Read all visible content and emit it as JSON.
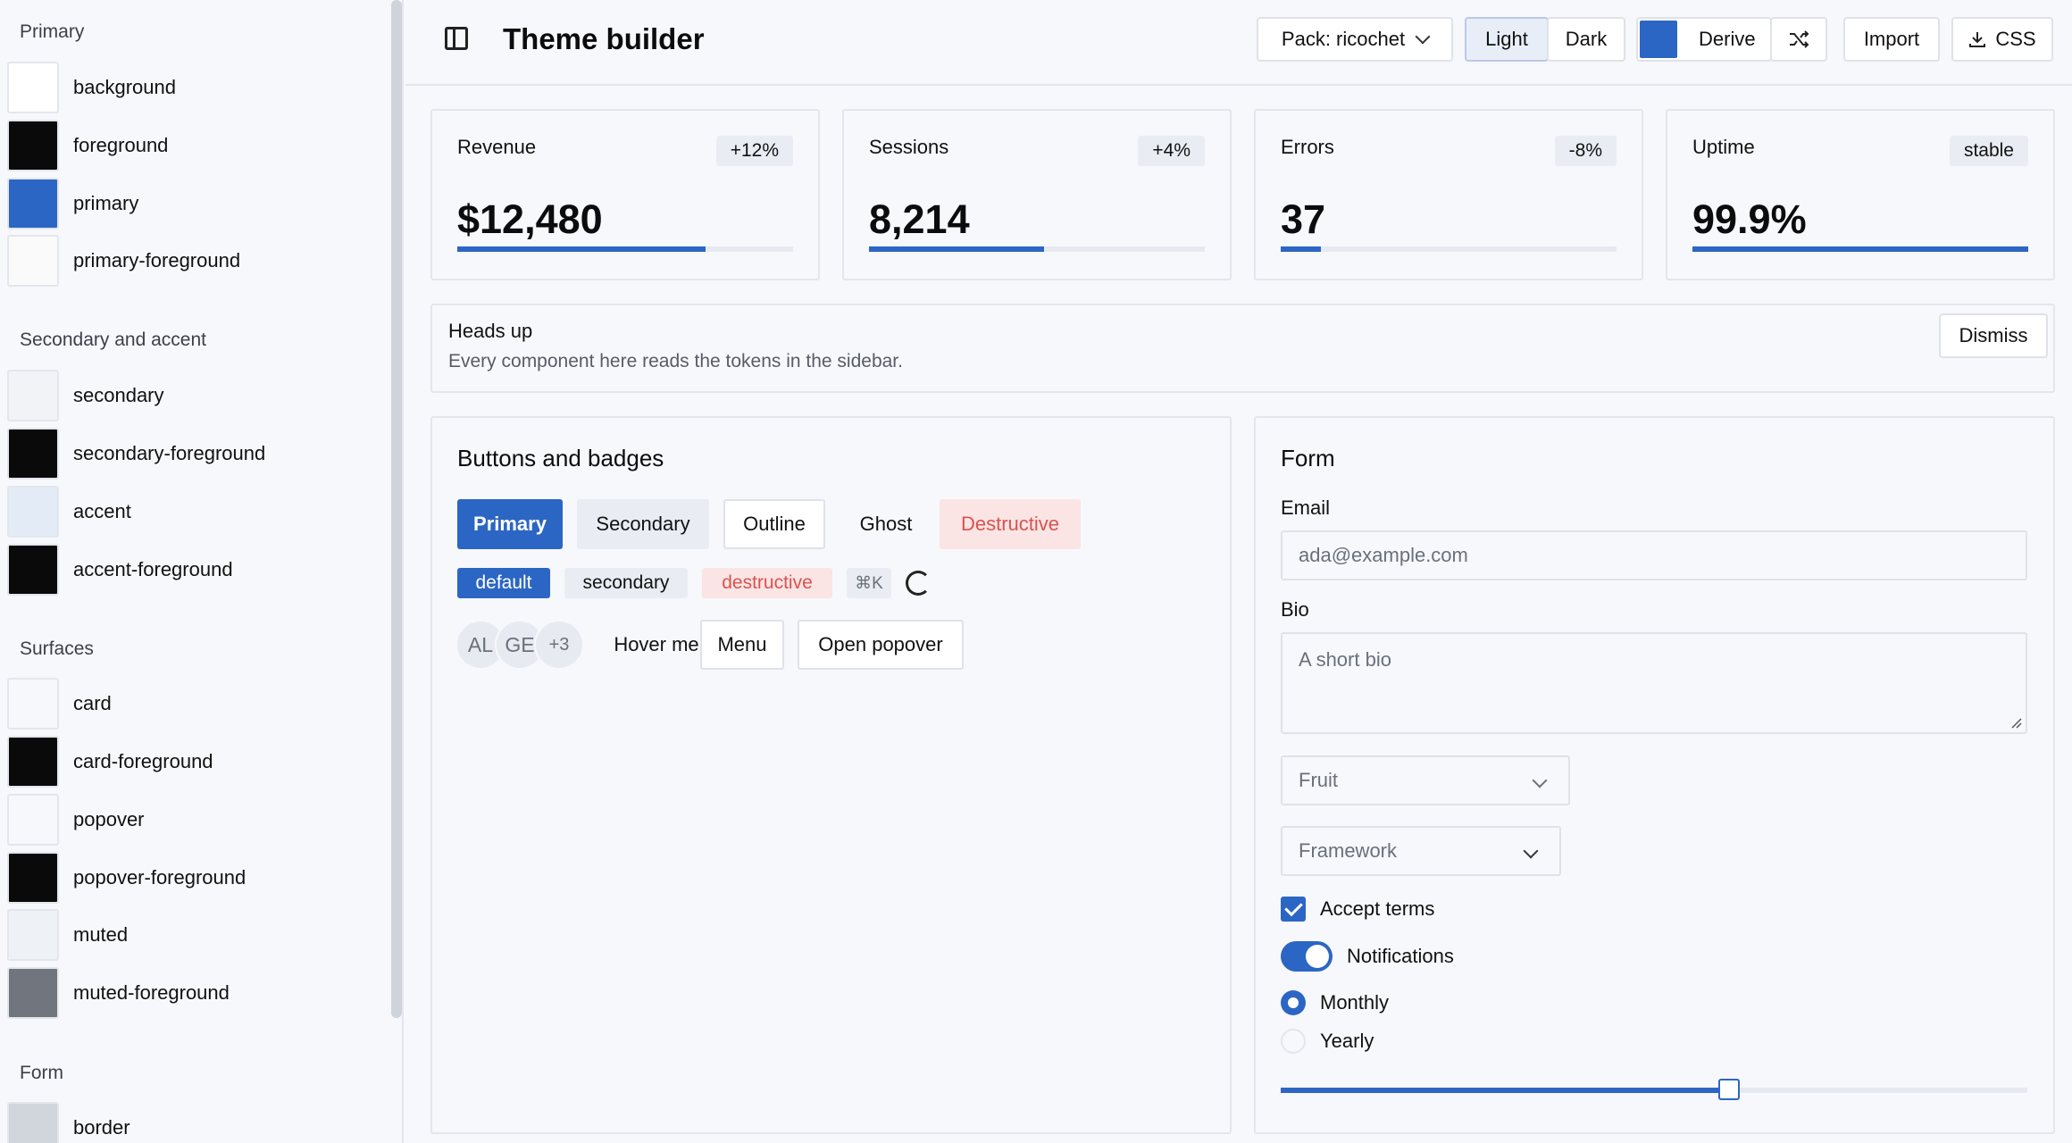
{
  "sidebar": {
    "groups": [
      {
        "title": "Primary",
        "tokens": [
          {
            "label": "background",
            "color": "#ffffff"
          },
          {
            "label": "foreground",
            "color": "#0a0a0a"
          },
          {
            "label": "primary",
            "color": "#2c66c4"
          },
          {
            "label": "primary-foreground",
            "color": "#fafafa"
          }
        ]
      },
      {
        "title": "Secondary and accent",
        "tokens": [
          {
            "label": "secondary",
            "color": "#f1f3f7"
          },
          {
            "label": "secondary-foreground",
            "color": "#0a0a0a"
          },
          {
            "label": "accent",
            "color": "#e3ebf7"
          },
          {
            "label": "accent-foreground",
            "color": "#0a0a0a"
          }
        ]
      },
      {
        "title": "Surfaces",
        "tokens": [
          {
            "label": "card",
            "color": "#f7f8fb"
          },
          {
            "label": "card-foreground",
            "color": "#0a0a0a"
          },
          {
            "label": "popover",
            "color": "#f7f8fb"
          },
          {
            "label": "popover-foreground",
            "color": "#0a0a0a"
          },
          {
            "label": "muted",
            "color": "#eef1f6"
          },
          {
            "label": "muted-foreground",
            "color": "#70757e"
          }
        ]
      },
      {
        "title": "Form",
        "tokens": [
          {
            "label": "border",
            "color": "#d1d5dc"
          }
        ]
      }
    ]
  },
  "header": {
    "title": "Theme builder",
    "pack_label": "Pack: ricochet",
    "light_label": "Light",
    "dark_label": "Dark",
    "derive_label": "Derive",
    "derive_color": "#2c66c4",
    "import_label": "Import",
    "css_label": "CSS"
  },
  "stats": [
    {
      "label": "Revenue",
      "badge": "+12%",
      "value": "$12,480",
      "progress": 0.74
    },
    {
      "label": "Sessions",
      "badge": "+4%",
      "value": "8,214",
      "progress": 0.52
    },
    {
      "label": "Errors",
      "badge": "-8%",
      "value": "37",
      "progress": 0.12
    },
    {
      "label": "Uptime",
      "badge": "stable",
      "value": "99.9%",
      "progress": 1.0
    }
  ],
  "alert": {
    "title": "Heads up",
    "description": "Every component here reads the tokens in the sidebar.",
    "dismiss_label": "Dismiss"
  },
  "buttons_panel": {
    "title": "Buttons and badges",
    "buttons": {
      "primary": "Primary",
      "secondary": "Secondary",
      "outline": "Outline",
      "ghost": "Ghost",
      "destructive": "Destructive"
    },
    "badges": {
      "default": "default",
      "secondary": "secondary",
      "destructive": "destructive",
      "kbd": "⌘K"
    },
    "avatars": [
      "AL",
      "GE",
      "+3"
    ],
    "hover_label": "Hover me",
    "menu_label": "Menu",
    "popover_label": "Open popover"
  },
  "form": {
    "title": "Form",
    "email_label": "Email",
    "email_placeholder": "ada@example.com",
    "bio_label": "Bio",
    "bio_placeholder": "A short bio",
    "fruit_placeholder": "Fruit",
    "framework_placeholder": "Framework",
    "accept_label": "Accept terms",
    "notifications_label": "Notifications",
    "monthly_label": "Monthly",
    "yearly_label": "Yearly",
    "slider_value": 0.6
  },
  "colors": {
    "primary": "#2c66c4",
    "destructive_text": "#d9534f",
    "destructive_bg": "#fbe4e4"
  }
}
